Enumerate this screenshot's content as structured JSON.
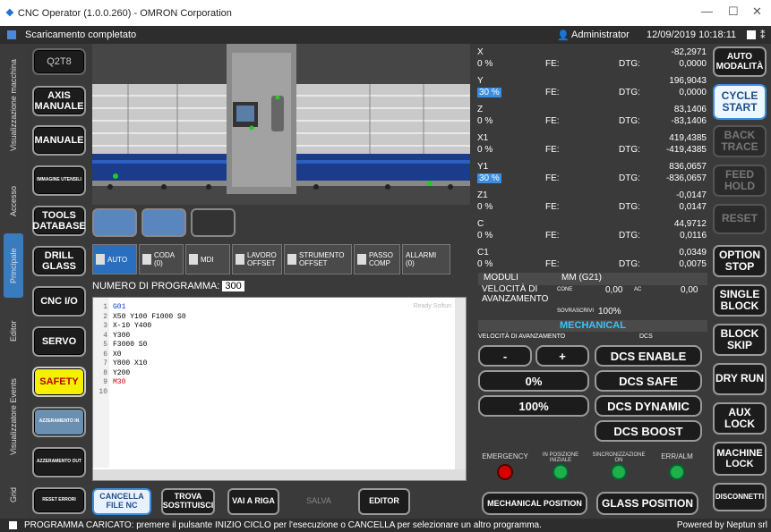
{
  "window": {
    "title": "CNC Operator (1.0.0.260) - OMRON Corporation"
  },
  "status": {
    "message": "Scaricamento completato",
    "user": "Administrator",
    "datetime": "12/09/2019 10:18:11"
  },
  "vertical_tabs": [
    "Visualizzazione macchina",
    "Accesso",
    "Principale",
    "Editor",
    "Visualizzatore Events",
    "Grid"
  ],
  "left_buttons": [
    {
      "label": "Q2T8"
    },
    {
      "label": "AXIS MANUALE"
    },
    {
      "label": "MANUALE"
    },
    {
      "label": "IMMAGINE UTENSILI"
    },
    {
      "label": "TOOLS DATABASE"
    },
    {
      "label": "DRILL GLASS"
    },
    {
      "label": "CNC I/O"
    },
    {
      "label": "SERVO"
    },
    {
      "label": "SAFETY"
    },
    {
      "label": "AZZERAMENTO IN"
    },
    {
      "label": "AZZERAMENTO OUT"
    },
    {
      "label": "RESET ERRORI"
    }
  ],
  "tabs": [
    {
      "label": "AUTO"
    },
    {
      "label": "CODA (0)"
    },
    {
      "label": "MDI"
    },
    {
      "label": "LAVORO OFFSET"
    },
    {
      "label": "STRUMENTO OFFSET"
    },
    {
      "label": "PASSO COMP"
    },
    {
      "label": "ALLARMI (0)"
    }
  ],
  "program": {
    "label": "NUMERO DI PROGRAMMA:",
    "number": "300",
    "ready": "Ready Softun"
  },
  "code_lines": [
    {
      "n": "1",
      "text": "G01"
    },
    {
      "n": "2",
      "text": "X50 Y100 F1000 S0"
    },
    {
      "n": "3",
      "text": "X-10 Y400"
    },
    {
      "n": "4",
      "text": "Y300"
    },
    {
      "n": "5",
      "text": "F3000 S0"
    },
    {
      "n": "6",
      "text": "X0"
    },
    {
      "n": "7",
      "text": "Y800 X10"
    },
    {
      "n": "8",
      "text": "Y200"
    },
    {
      "n": "9",
      "text": "M30"
    },
    {
      "n": "10",
      "text": ""
    }
  ],
  "bottom_buttons": [
    {
      "label": "CANCELLA FILE NC"
    },
    {
      "label": "TROVA SOSTITUISCI"
    },
    {
      "label": "VAI A RIGA"
    },
    {
      "label": "SALVA"
    },
    {
      "label": "EDITOR"
    }
  ],
  "axes": [
    {
      "name": "X",
      "value": "-82,2971",
      "pct": "0 %",
      "fe": "FE:",
      "dtg": "DTG:",
      "dtg_value": "0,0000",
      "hl": false
    },
    {
      "name": "Y",
      "value": "196,9043",
      "pct": "30 %",
      "fe": "FE:",
      "dtg": "DTG:",
      "dtg_value": "0,0000",
      "hl": true
    },
    {
      "name": "Z",
      "value": "83,1406",
      "pct": "0 %",
      "fe": "FE:",
      "dtg": "DTG:",
      "dtg_value": "-83,1406",
      "hl": false
    },
    {
      "name": "X1",
      "value": "419,4385",
      "pct": "0 %",
      "fe": "FE:",
      "dtg": "DTG:",
      "dtg_value": "-419,4385",
      "hl": false
    },
    {
      "name": "Y1",
      "value": "836,0657",
      "pct": "30 %",
      "fe": "FE:",
      "dtg": "DTG:",
      "dtg_value": "-836,0657",
      "hl": true
    },
    {
      "name": "Z1",
      "value": "-0,0147",
      "pct": "0 %",
      "fe": "FE:",
      "dtg": "DTG:",
      "dtg_value": "0,0147",
      "hl": false
    },
    {
      "name": "C",
      "value": "44,9712",
      "pct": "0 %",
      "fe": "FE:",
      "dtg": "DTG:",
      "dtg_value": "0,0116",
      "hl": false
    },
    {
      "name": "C1",
      "value": "0,0349",
      "pct": "0 %",
      "fe": "FE:",
      "dtg": "DTG:",
      "dtg_value": "0,0075",
      "hl": false
    }
  ],
  "info": {
    "moduli_label": "MODULI",
    "moduli_value": "MM (G21)",
    "vel_label": "VELOCITÀ DI AVANZAMENTO",
    "cone_label": "CONE",
    "cone_value": "0,00",
    "act_label": "AC",
    "act_value": "0,00",
    "override_label": "SOVRASCRIVI",
    "override_value": "100%",
    "section": "MECHANICAL",
    "feed_title": "VELOCITÀ DI AVANZAMENTO",
    "dcs_title": "DCS"
  },
  "panel_buttons": {
    "minus": "-",
    "plus": "+",
    "pct0": "0%",
    "pct100": "100%",
    "dcs_enable": "DCS ENABLE",
    "dcs_safe": "DCS SAFE",
    "dcs_dynamic": "DCS DYNAMIC",
    "dcs_boost": "DCS BOOST",
    "mech_pos": "MECHANICAL POSITION",
    "glass_pos": "GLASS POSITION"
  },
  "leds": [
    {
      "label": "EMERGENCY",
      "color": "#d40000"
    },
    {
      "label": "IN POSIZIONE INIZIALE",
      "color": "#1fb04a"
    },
    {
      "label": "SINCRONIZZAZIONE ON",
      "color": "#1fb04a"
    },
    {
      "label": "ERR/ALM",
      "color": "#1fb04a"
    }
  ],
  "right_buttons": [
    {
      "label": "AUTO MODALITÀ"
    },
    {
      "label": "CYCLE START"
    },
    {
      "label": "BACK TRACE"
    },
    {
      "label": "FEED HOLD"
    },
    {
      "label": "RESET"
    },
    {
      "label": "OPTION STOP"
    },
    {
      "label": "SINGLE BLOCK"
    },
    {
      "label": "BLOCK SKIP"
    },
    {
      "label": "DRY RUN"
    },
    {
      "label": "AUX LOCK"
    },
    {
      "label": "MACHINE LOCK"
    },
    {
      "label": "DISCONNETTI"
    }
  ],
  "footer": {
    "message": "PROGRAMMA CARICATO: premere il pulsante INIZIO CICLO per l'esecuzione o CANCELLA per selezionare un altro programma.",
    "powered": "Powered by Neptun srl"
  }
}
